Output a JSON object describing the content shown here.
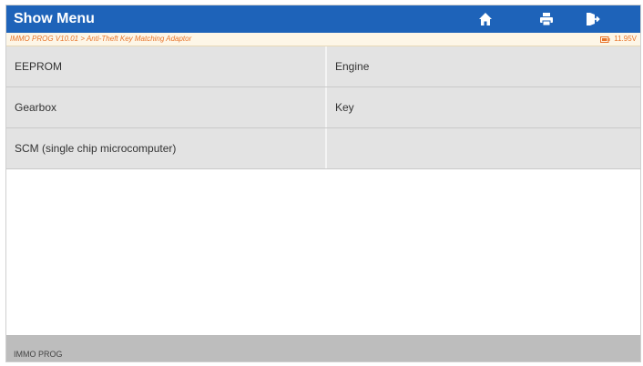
{
  "header": {
    "title": "Show Menu",
    "icons": [
      "home-icon",
      "print-icon",
      "exit-icon"
    ],
    "bg_color": "#1e63b9"
  },
  "path_bar": {
    "path": "IMMO PROG  V10.01 > Anti-Theft Key Matching Adaptor",
    "voltage": "11.95V",
    "text_color": "#e8742a"
  },
  "menu": {
    "items": [
      {
        "label": "EEPROM"
      },
      {
        "label": "Engine"
      },
      {
        "label": "Gearbox"
      },
      {
        "label": "Key"
      },
      {
        "label": "SCM (single chip microcomputer)"
      }
    ]
  },
  "status_bar": {
    "label": "IMMO PROG"
  }
}
